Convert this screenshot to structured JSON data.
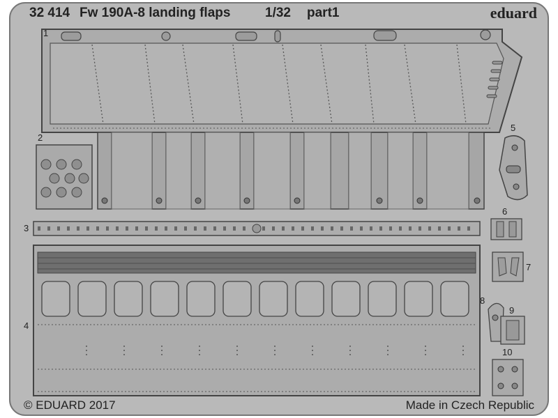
{
  "header": {
    "code": "32 414",
    "title": "Fw 190A-8 landing flaps",
    "scale": "1/32",
    "part": "part1",
    "brand": "eduard"
  },
  "footer": {
    "copyright": "© EDUARD 2017",
    "origin": "Made in Czech Republic"
  },
  "part_numbers": [
    "1",
    "2",
    "3",
    "4",
    "5",
    "6",
    "7",
    "8",
    "9",
    "10"
  ],
  "colors": {
    "fret_face": "#b7b7b7",
    "part_face": "#a9a9a9",
    "etch_line": "#555555",
    "outline": "#444444"
  }
}
